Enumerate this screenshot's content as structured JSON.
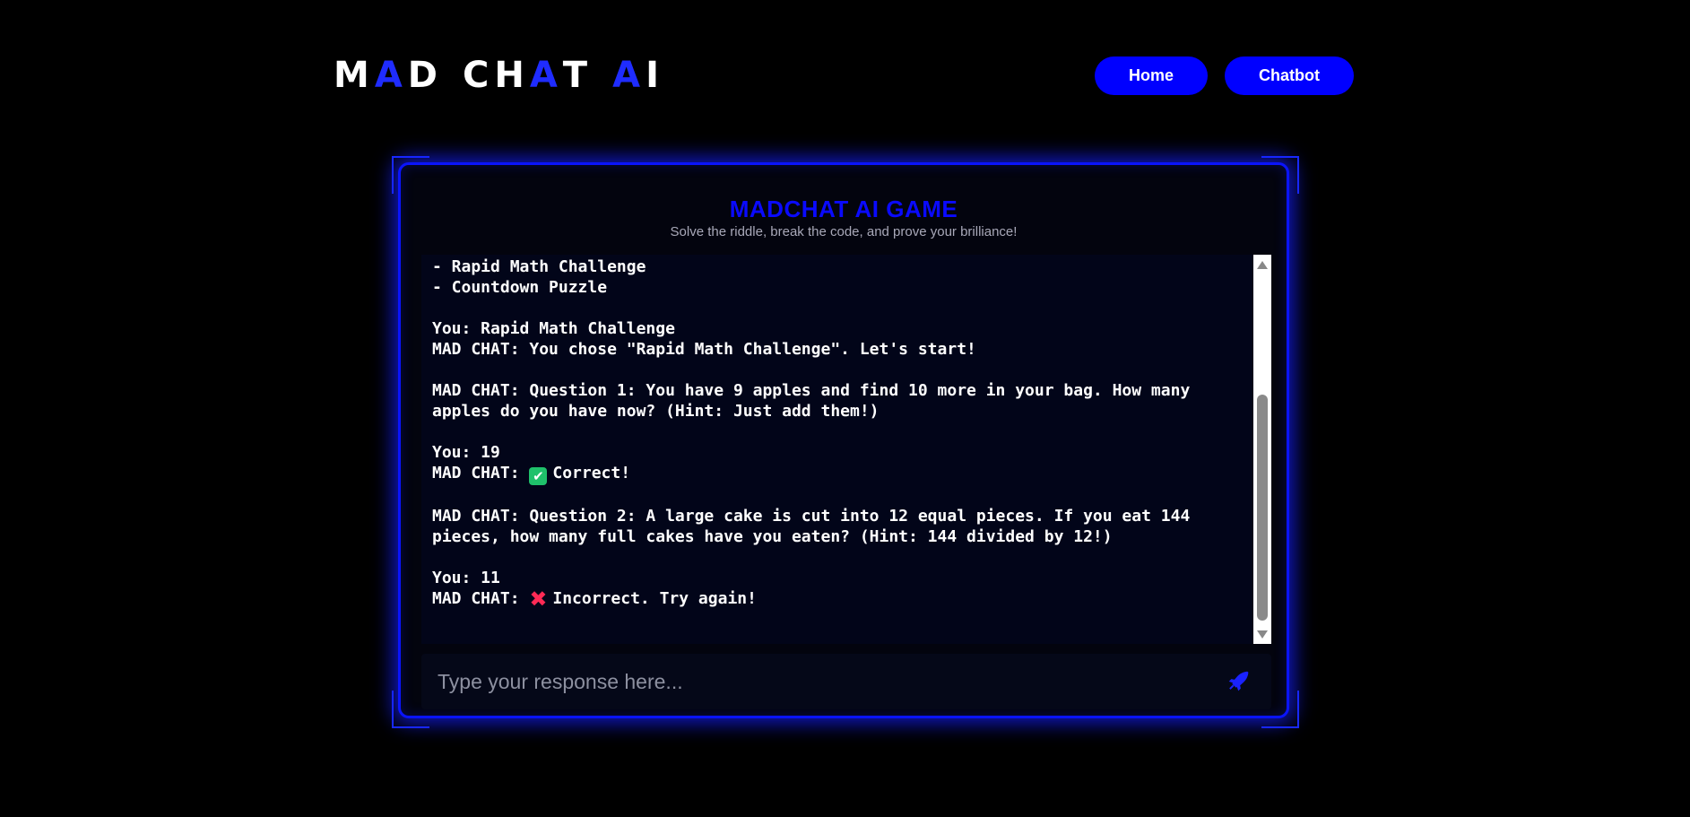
{
  "header": {
    "logo_letters": [
      {
        "ch": "M",
        "color": "white"
      },
      {
        "ch": "A",
        "color": "blue"
      },
      {
        "ch": "D",
        "color": "white"
      },
      {
        "ch": " ",
        "color": "space"
      },
      {
        "ch": "C",
        "color": "white"
      },
      {
        "ch": "H",
        "color": "white"
      },
      {
        "ch": "A",
        "color": "blue"
      },
      {
        "ch": "T",
        "color": "white"
      },
      {
        "ch": " ",
        "color": "space"
      },
      {
        "ch": "A",
        "color": "blue"
      },
      {
        "ch": "I",
        "color": "white"
      }
    ],
    "logo_text": "MAD CHAT AI",
    "nav": {
      "home_label": "Home",
      "chatbot_label": "Chatbot"
    }
  },
  "game": {
    "title": "MADCHAT AI GAME",
    "subtitle": "Solve the riddle, break the code, and prove your brilliance!",
    "chat_lines": [
      {
        "text": "- Rapid Math Challenge"
      },
      {
        "text": "- Countdown Puzzle"
      },
      {
        "text": ""
      },
      {
        "text": "You: Rapid Math Challenge"
      },
      {
        "text": "MAD CHAT: You chose \"Rapid Math Challenge\". Let's start!"
      },
      {
        "text": ""
      },
      {
        "text": "MAD CHAT: Question 1: You have 9 apples and find 10 more in your bag. How many apples do you have now? (Hint: Just add them!)"
      },
      {
        "text": ""
      },
      {
        "text": "You: 19"
      },
      {
        "prefix": "MAD CHAT: ",
        "icon": "check-mark-icon",
        "text": "Correct!"
      },
      {
        "text": ""
      },
      {
        "text": "MAD CHAT: Question 2: A large cake is cut into 12 equal pieces. If you eat 144 pieces, how many full cakes have you eaten? (Hint: 144 divided by 12!)"
      },
      {
        "text": ""
      },
      {
        "text": "You: 11"
      },
      {
        "prefix": "MAD CHAT: ",
        "icon": "cross-mark-icon",
        "text": "Incorrect. Try again!"
      }
    ],
    "input": {
      "placeholder": "Type your response here...",
      "value": ""
    },
    "send_icon": "rocket-icon"
  },
  "colors": {
    "background": "#000000",
    "accent_blue": "#0000ff",
    "title_blue": "#0a0aff",
    "panel_bg": "#03040e",
    "correct_green": "#1fc16b",
    "incorrect_red": "#ff2a55"
  }
}
